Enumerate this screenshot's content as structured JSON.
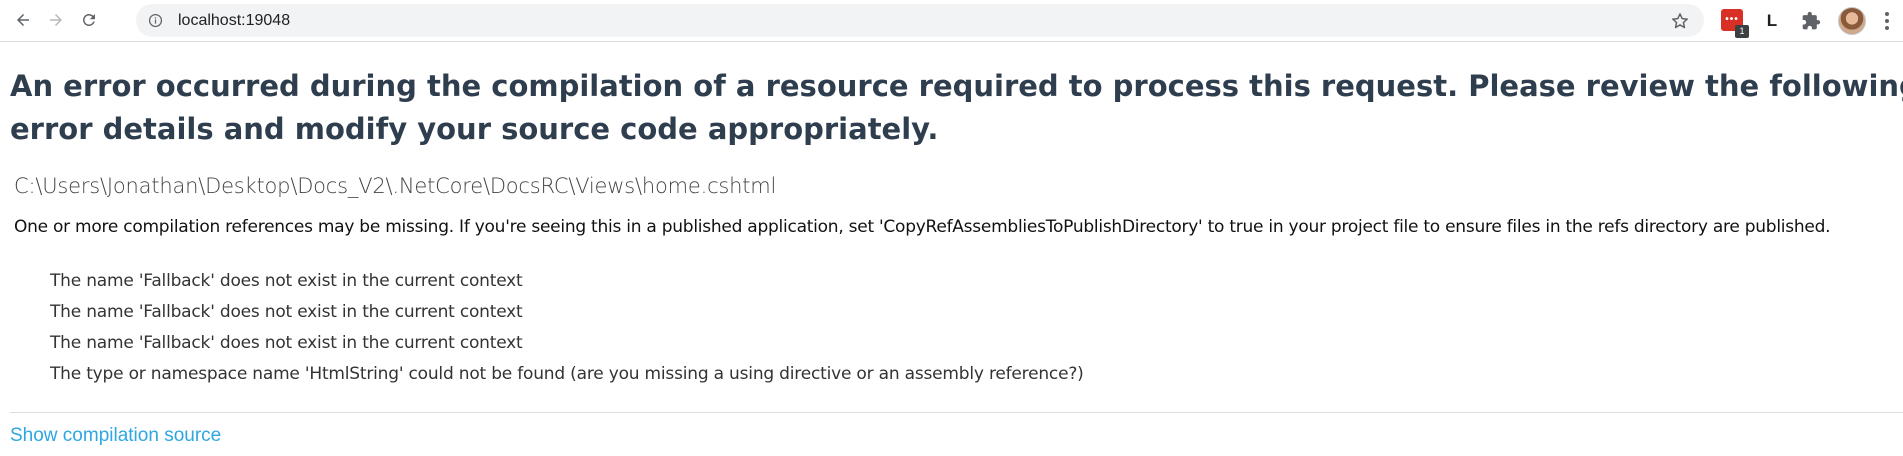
{
  "browser": {
    "url": "localhost:19048",
    "extension_letter": "L",
    "extension_badge_count": "1",
    "icons": {
      "back": "arrow-left-icon",
      "forward": "arrow-right-icon",
      "reload": "reload-icon",
      "site_info": "info-icon",
      "bookmark": "star-icon",
      "extensions": "puzzle-icon",
      "menu": "kebab-menu-icon"
    }
  },
  "page": {
    "title_line1": "An error occurred during the compilation of a resource required to process this request. Please review the following specific",
    "title_line2": "error details and modify your source code appropriately.",
    "file_path": "C:\\Users\\Jonathan\\Desktop\\Docs_V2\\.NetCore\\DocsRC\\Views\\home.cshtml",
    "explanation": "One or more compilation references may be missing. If you're seeing this in a published application, set 'CopyRefAssembliesToPublishDirectory' to true in your project file to ensure files in the refs directory are published.",
    "errors": [
      "The name 'Fallback' does not exist in the current context",
      "The name 'Fallback' does not exist in the current context",
      "The name 'Fallback' does not exist in the current context",
      "The type or namespace name 'HtmlString' could not be found (are you missing a using directive or an assembly reference?)"
    ],
    "show_source_label": "Show compilation source"
  },
  "colors": {
    "title": "#2f3e4e",
    "link": "#2ea7e0",
    "omnibox_bg": "#f1f3f4"
  }
}
